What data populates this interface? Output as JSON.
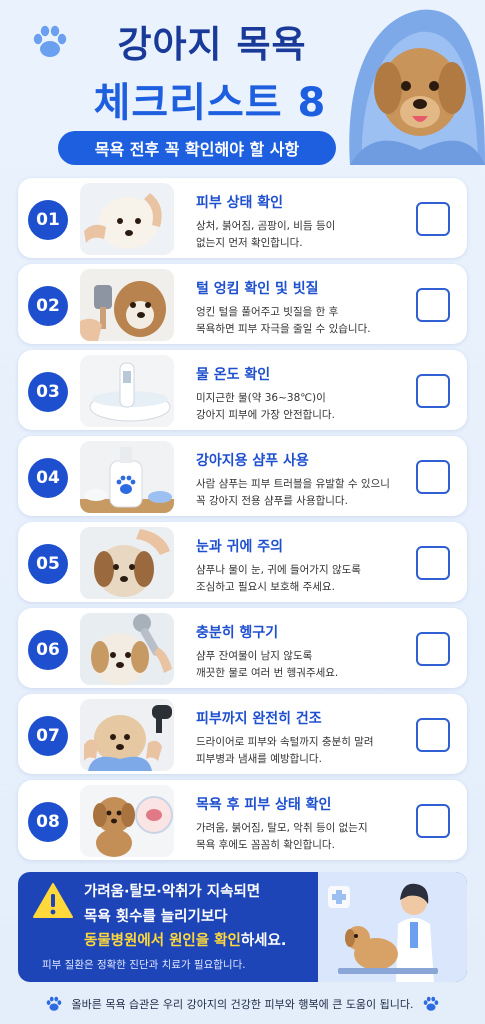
{
  "header": {
    "title_line1": "강아지 목욕",
    "title_line2": "체크리스트 8",
    "subtitle": "목욕 전후 꼭 확인해야 할 사항"
  },
  "items": [
    {
      "num": "01",
      "title": "피부 상태 확인",
      "desc1": "상처, 붉어짐, 곰팡이, 비듬 등이",
      "desc2": "없는지 먼저 확인합니다."
    },
    {
      "num": "02",
      "title": "털 엉킴 확인 및 빗질",
      "desc1": "엉킨 털을 풀어주고 빗질을 한 후",
      "desc2": "목욕하면 피부 자극을 줄일 수 있습니다."
    },
    {
      "num": "03",
      "title": "물 온도 확인",
      "desc1": "미지근한 물(약 36~38℃)이",
      "desc2": "강아지 피부에 가장 안전합니다."
    },
    {
      "num": "04",
      "title": "강아지용 샴푸 사용",
      "desc1": "사람 샴푸는 피부 트러블을 유발할 수 있으니",
      "desc2": "꼭 강아지 전용 샴푸를 사용합니다."
    },
    {
      "num": "05",
      "title": "눈과 귀에 주의",
      "desc1": "샴푸나 물이 눈, 귀에 들어가지 않도록",
      "desc2": "조심하고 필요시 보호해 주세요."
    },
    {
      "num": "06",
      "title": "충분히 헹구기",
      "desc1": "샴푸 잔여물이 남지 않도록",
      "desc2": "깨끗한 물로 여러 번 헹궈주세요."
    },
    {
      "num": "07",
      "title": "피부까지 완전히 건조",
      "desc1": "드라이어로 피부와 속털까지 충분히 말려",
      "desc2": "피부병과 냄새를 예방합니다."
    },
    {
      "num": "08",
      "title": "목욕 후 피부 상태 확인",
      "desc1": "가려움, 붉어짐, 탈모, 악취 등이 없는지",
      "desc2": "목욕 후에도 꼼꼼히 확인합니다."
    }
  ],
  "warning": {
    "line1": "가려움·탈모·악취가 지속되면",
    "line2": "목욕 횟수를 늘리기보다",
    "line3_highlight": "동물병원에서 원인을 확인",
    "line3_rest": "하세요.",
    "note": "피부 질환은 정확한 진단과 치료가 필요합니다."
  },
  "footer": {
    "text": "올바른 목욕 습관은 우리 강아지의 건강한 피부와 행복에 큰 도움이 됩니다."
  },
  "colors": {
    "primary": "#1e4fcf",
    "title_dark": "#1a3a9a",
    "highlight": "#ffd83b",
    "background": "#eaf2fd"
  }
}
